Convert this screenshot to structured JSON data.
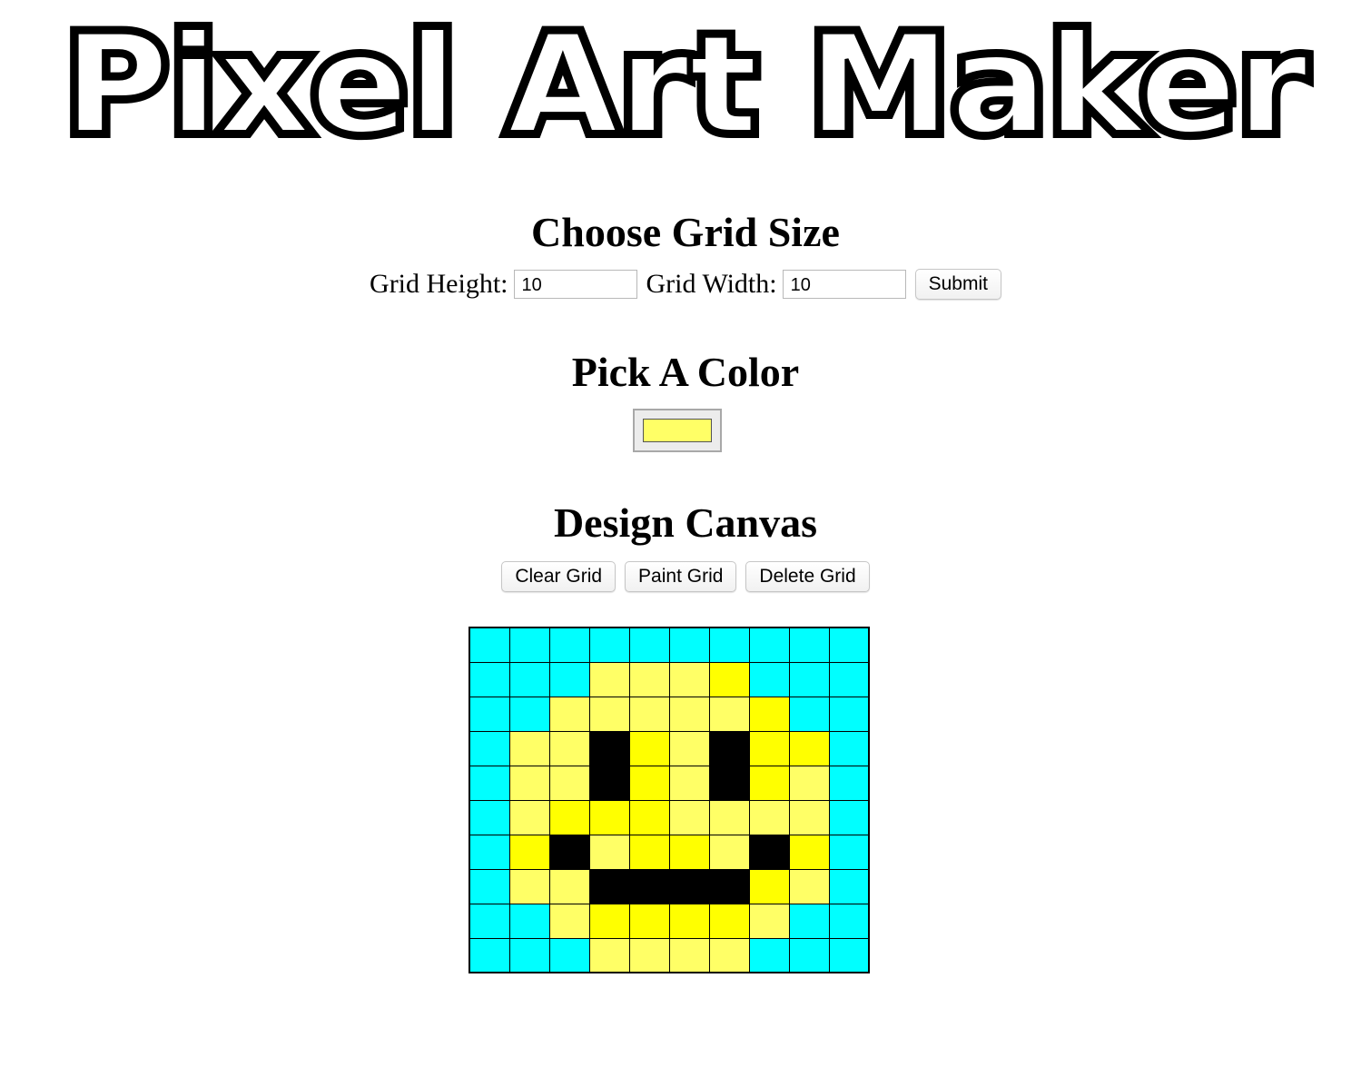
{
  "app": {
    "title": "Pixel Art Maker"
  },
  "grid_size": {
    "heading": "Choose Grid Size",
    "height_label": "Grid Height:",
    "height_value": "10",
    "width_label": "Grid Width:",
    "width_value": "10",
    "submit_label": "Submit"
  },
  "color": {
    "heading": "Pick A Color",
    "selected": "#ffff66"
  },
  "canvas": {
    "heading": "Design Canvas",
    "clear_label": "Clear Grid",
    "paint_label": "Paint Grid",
    "delete_label": "Delete Grid",
    "rows": 10,
    "cols": 10,
    "palette": {
      "C": "#00ffff",
      "Y": "#ffff66",
      "B": "#ffff00",
      "K": "#000000"
    },
    "cells": [
      "CCCCCCCCCC",
      "CCCYYYBCCC",
      "CCYYYYYBCC",
      "CYYKBYKBBC",
      "CYYKBYKBYC",
      "CYBBBYYYYC",
      "CBKYBBYKBC",
      "CYYKKKKBYC",
      "CCYBBBBYCC",
      "CCCYYYYCCC"
    ]
  }
}
